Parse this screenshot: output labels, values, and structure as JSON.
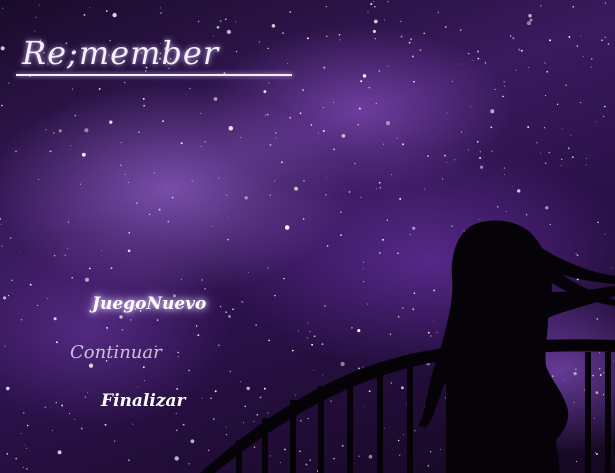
{
  "game": {
    "title": "Re;member"
  },
  "menu": {
    "items": [
      {
        "label": "JuegoNuevo",
        "state": "selected"
      },
      {
        "label": "Continuar",
        "state": "disabled"
      },
      {
        "label": "Finalizar",
        "state": "normal"
      }
    ]
  },
  "colors": {
    "sky_dark": "#1a0b2a",
    "nebula_purple": "#3a1a5e",
    "text_white": "#ffffff",
    "text_disabled": "#c9c3d6"
  }
}
